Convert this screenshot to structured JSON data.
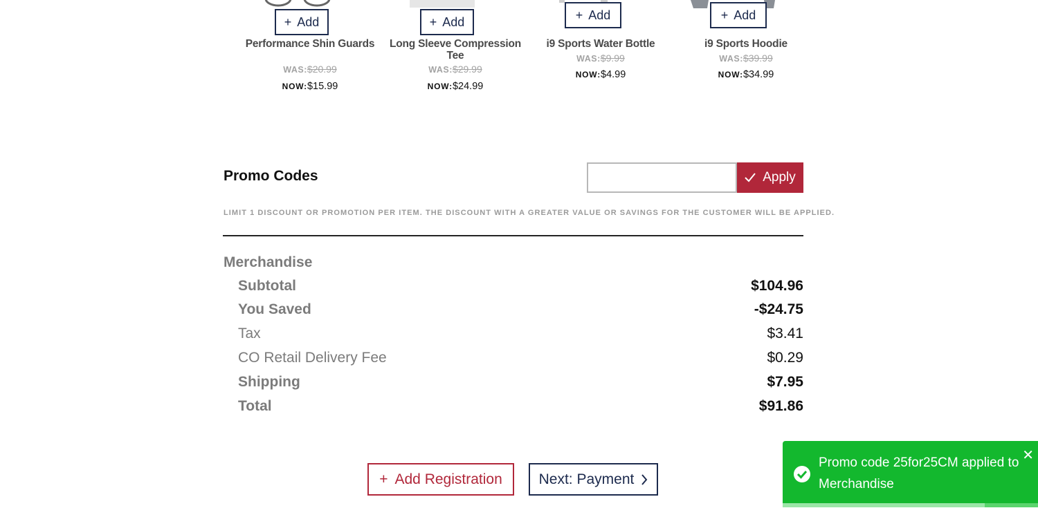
{
  "products": [
    {
      "name": "Performance Shin Guards",
      "was_label": "WAS:",
      "was_price": "$20.99",
      "now_label": "NOW:",
      "now_price": "$15.99",
      "add_label": "Add",
      "thumb_icon": "shin-guards-image"
    },
    {
      "name": "Long Sleeve Compression Tee",
      "was_label": "WAS:",
      "was_price": "$29.99",
      "now_label": "NOW:",
      "now_price": "$24.99",
      "add_label": "Add",
      "thumb_icon": "compression-tee-image"
    },
    {
      "name": "i9 Sports Water Bottle",
      "was_label": "WAS:",
      "was_price": "$9.99",
      "now_label": "NOW:",
      "now_price": "$4.99",
      "add_label": "Add",
      "thumb_icon": "water-bottle-image"
    },
    {
      "name": "i9 Sports Hoodie",
      "was_label": "WAS:",
      "was_price": "$39.99",
      "now_label": "NOW:",
      "now_price": "$34.99",
      "add_label": "Add",
      "thumb_icon": "hoodie-image"
    }
  ],
  "promo": {
    "title": "Promo Codes",
    "input_value": "",
    "apply_label": "Apply",
    "disclaimer": "LIMIT 1 DISCOUNT OR PROMOTION PER ITEM. THE DISCOUNT WITH A GREATER VALUE OR SAVINGS FOR THE CUSTOMER WILL BE APPLIED."
  },
  "summary": {
    "section_title": "Merchandise",
    "rows": [
      {
        "label": "Subtotal",
        "value": "$104.96",
        "bold": true
      },
      {
        "label": "You Saved",
        "value": "-$24.75",
        "bold": true
      },
      {
        "label": "Tax",
        "value": "$3.41",
        "bold": false
      },
      {
        "label": "CO Retail Delivery Fee",
        "value": "$0.29",
        "bold": false
      },
      {
        "label": "Shipping",
        "value": "$7.95",
        "bold": true
      },
      {
        "label": "Total",
        "value": "$91.86",
        "bold": true
      }
    ]
  },
  "actions": {
    "add_registration_label": "Add Registration",
    "next_payment_label": "Next: Payment"
  },
  "toast": {
    "message": "Promo code 25for25CM applied to Merchandise",
    "progress": 0.79,
    "close_icon": "close-icon"
  },
  "colors": {
    "brand_red": "#b1273a",
    "brand_navy": "#1c2a4d",
    "toast_green": "#13b82e"
  }
}
